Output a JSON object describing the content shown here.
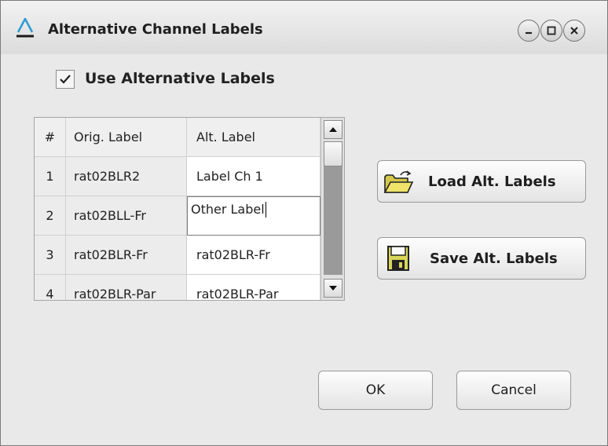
{
  "window": {
    "title": "Alternative Channel Labels",
    "accent_color": "#2a9bd0",
    "controls": [
      "minimize-icon",
      "maximize-icon",
      "close-icon"
    ]
  },
  "use_alt_labels": {
    "checked": true,
    "label": "Use Alternative Labels"
  },
  "table": {
    "headers": [
      "#",
      "Orig. Label",
      "Alt. Label"
    ],
    "rows": [
      {
        "num": "1",
        "orig": "rat02BLR2",
        "alt": "Label Ch 1"
      },
      {
        "num": "2",
        "orig": "rat02BLL-Fr",
        "alt": "Other Label"
      },
      {
        "num": "3",
        "orig": "rat02BLR-Fr",
        "alt": "rat02BLR-Fr"
      },
      {
        "num": "4",
        "orig": "rat02BLR-Par",
        "alt": "rat02BLR-Par"
      }
    ]
  },
  "buttons": {
    "load": "Load Alt. Labels",
    "save": "Save Alt. Labels",
    "ok": "OK",
    "cancel": "Cancel"
  }
}
